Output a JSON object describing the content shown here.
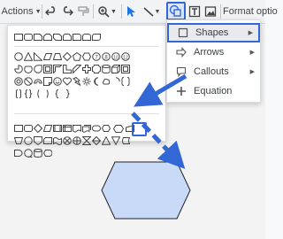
{
  "toolbar": {
    "actions_label": "Actions",
    "format_label": "Format optio",
    "icons": [
      "undo-icon",
      "redo-icon",
      "paint-format-icon",
      "zoom-icon",
      "select-icon",
      "line-icon",
      "shape-icon",
      "textbox-icon",
      "image-icon"
    ]
  },
  "shape_menu": {
    "items": [
      {
        "label": "Shapes",
        "icon": "square-icon",
        "has_submenu": true,
        "active": true
      },
      {
        "label": "Arrows",
        "icon": "arrow-icon",
        "has_submenu": true,
        "active": false
      },
      {
        "label": "Callouts",
        "icon": "callout-icon",
        "has_submenu": true,
        "active": false
      },
      {
        "label": "Equation",
        "icon": "plus-icon",
        "has_submenu": false,
        "active": false
      }
    ]
  },
  "colors": {
    "accent": "#3367d6",
    "shape_fill": "#c9daf8",
    "shape_stroke": "#202124"
  }
}
